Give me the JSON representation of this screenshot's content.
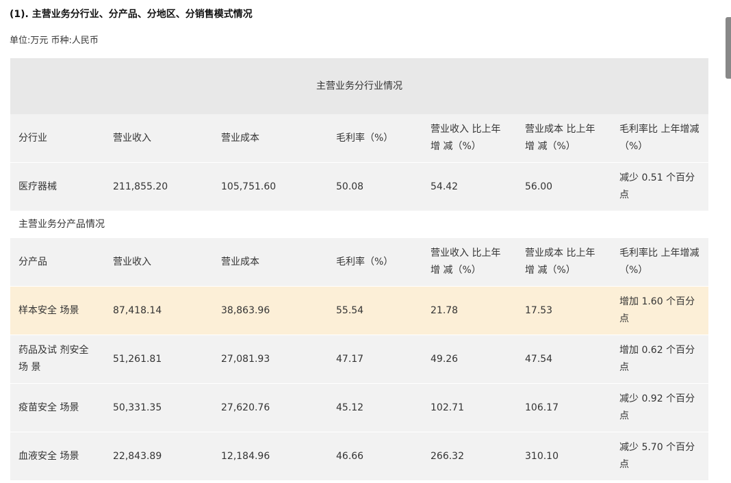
{
  "title": "(1). 主营业务分行业、分产品、分地区、分销售模式情况",
  "unit": "单位:万元 币种:人民币",
  "icons": {
    "copy": "copy-icon"
  },
  "industry_table": {
    "caption": "主营业务分行业情况",
    "headers": [
      "分行业",
      "营业收入",
      "营业成本",
      "毛利率（%）",
      "营业收入 比上年增 减（%）",
      "营业成本 比上年增 减（%）",
      "毛利率比 上年增减 （%）"
    ],
    "rows": [
      [
        "医疗器械",
        "211,855.20",
        "105,751.60",
        "50.08",
        "54.42",
        "56.00",
        "减少 0.51 个百分点"
      ]
    ]
  },
  "product_table": {
    "caption": "主营业务分产品情况",
    "headers": [
      "分产品",
      "营业收入",
      "营业成本",
      "毛利率（%）",
      "营业收入 比上年增 减（%）",
      "营业成本 比上年增 减（%）",
      "毛利率比 上年增减 （%）"
    ],
    "rows": [
      [
        "样本安全 场景",
        "87,418.14",
        "38,863.96",
        "55.54",
        "21.78",
        "17.53",
        "增加 1.60 个百分点"
      ],
      [
        "药品及试 剂安全场 景",
        "51,261.81",
        "27,081.93",
        "47.17",
        "49.26",
        "47.54",
        "增加 0.62 个百分点"
      ],
      [
        "疫苗安全 场景",
        "50,331.35",
        "27,620.76",
        "45.12",
        "102.71",
        "106.17",
        "减少 0.92 个百分点"
      ],
      [
        "血液安全 场景",
        "22,843.89",
        "12,184.96",
        "46.66",
        "266.32",
        "310.10",
        "减少 5.70 个百分点"
      ]
    ]
  }
}
